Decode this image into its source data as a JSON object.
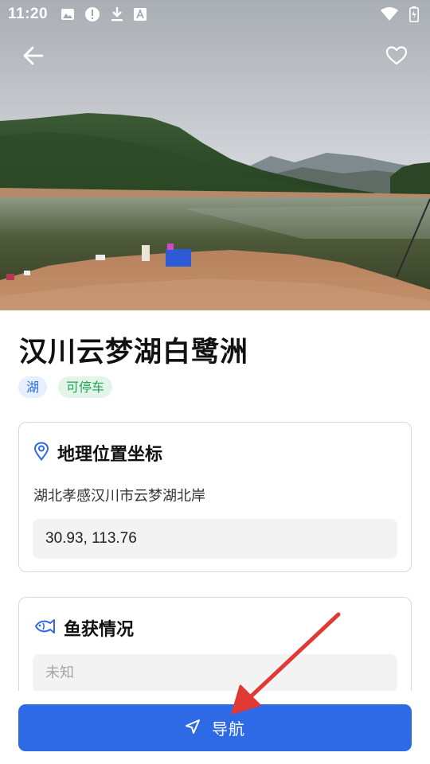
{
  "status_bar": {
    "time": "11:20",
    "icons_left": [
      "image-icon",
      "alert-circle-icon",
      "download-icon",
      "text-a-icon"
    ],
    "icons_right": [
      "wifi-icon",
      "battery-icon"
    ]
  },
  "header": {
    "back_icon": "arrow-left-icon",
    "favorite_icon": "heart-outline-icon"
  },
  "place": {
    "title": "汉川云梦湖白鹭洲",
    "tags": [
      {
        "label": "湖",
        "color": "#2d6be5",
        "bg": "#e6effd"
      },
      {
        "label": "可停车",
        "color": "#23a35a",
        "bg": "#e2f5e8"
      }
    ]
  },
  "location_card": {
    "icon": "map-pin-icon",
    "title": "地理位置坐标",
    "address": "湖北孝感汉川市云梦湖北岸",
    "coordinates": "30.93, 113.76"
  },
  "catch_card": {
    "icon": "fish-icon",
    "title": "鱼获情况",
    "value": "未知"
  },
  "bottom": {
    "nav_icon": "navigation-arrow-icon",
    "nav_label": "导航"
  },
  "colors": {
    "primary": "#2f6ae6",
    "annotation": "#e03a36"
  }
}
